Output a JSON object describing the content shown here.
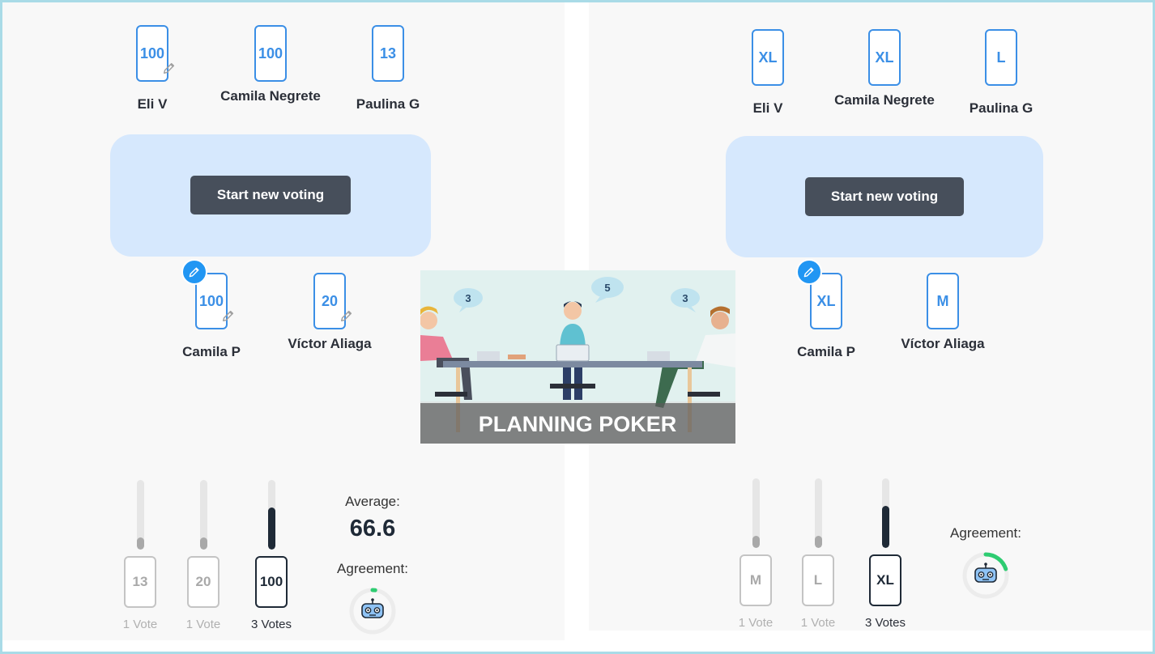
{
  "left": {
    "players_top": [
      {
        "name": "Eli V",
        "card": "100",
        "edit": true
      },
      {
        "name": "Camila Negrete",
        "card": "100",
        "edit": false
      },
      {
        "name": "Paulina G",
        "card": "13",
        "edit": false
      }
    ],
    "players_bottom": [
      {
        "name": "Camila P",
        "card": "100",
        "edit": true
      },
      {
        "name": "Víctor Aliaga",
        "card": "20",
        "edit": true
      }
    ],
    "button_label": "Start new voting",
    "results": [
      {
        "value": "13",
        "count": "1 Vote",
        "fraction": 0.18
      },
      {
        "value": "20",
        "count": "1 Vote",
        "fraction": 0.18
      },
      {
        "value": "100",
        "count": "3 Votes",
        "fraction": 0.6
      }
    ],
    "average_label": "Average:",
    "average_value": "66.6",
    "agreement_label": "Agreement:",
    "agreement_fraction": 0.02
  },
  "right": {
    "players_top": [
      {
        "name": "Eli V",
        "card": "XL",
        "edit": false
      },
      {
        "name": "Camila Negrete",
        "card": "XL",
        "edit": false
      },
      {
        "name": "Paulina G",
        "card": "L",
        "edit": false
      }
    ],
    "players_bottom": [
      {
        "name": "Camila P",
        "card": "XL",
        "edit": false
      },
      {
        "name": "Víctor Aliaga",
        "card": "M",
        "edit": false
      }
    ],
    "button_label": "Start new voting",
    "results": [
      {
        "value": "M",
        "count": "1 Vote",
        "fraction": 0.18
      },
      {
        "value": "L",
        "count": "1 Vote",
        "fraction": 0.18
      },
      {
        "value": "XL",
        "count": "3 Votes",
        "fraction": 0.6
      }
    ],
    "agreement_label": "Agreement:",
    "agreement_fraction": 0.2
  },
  "overlay": {
    "title": "PLANNING POKER",
    "bubbles": [
      "3",
      "5",
      "3"
    ]
  },
  "icons": {
    "edit": "pencil-icon",
    "agreement": "robot-icon"
  },
  "colors": {
    "card_blue": "#3b8fe6",
    "table_blue": "#d6e8fd",
    "button_dark": "#474f5b",
    "edit_badge": "#2196f3",
    "agreement_green": "#2ecc71"
  }
}
